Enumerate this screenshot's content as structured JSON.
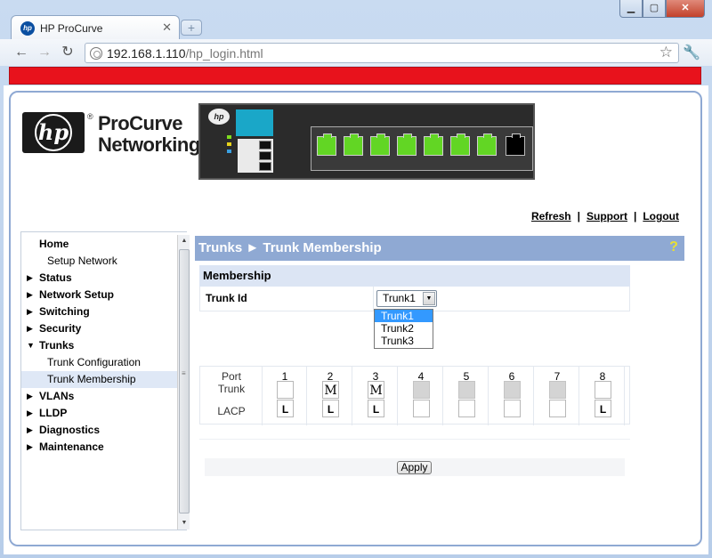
{
  "browser": {
    "tab_title": "HP ProCurve",
    "url_host": "192.168.1.110",
    "url_path": "/hp_login.html",
    "favicon_label": "hp"
  },
  "header": {
    "logo_text": "hp",
    "reg_mark": "®",
    "brand_line1": "ProCurve",
    "brand_line2": "Networking",
    "links": [
      "Refresh",
      "Support",
      "Logout"
    ]
  },
  "sidebar": {
    "items": [
      {
        "label": "Home",
        "sub": false,
        "arrow": ""
      },
      {
        "label": "Setup Network",
        "sub": true,
        "arrow": ""
      },
      {
        "label": "Status",
        "sub": false,
        "arrow": "▶"
      },
      {
        "label": "Network Setup",
        "sub": false,
        "arrow": "▶"
      },
      {
        "label": "Switching",
        "sub": false,
        "arrow": "▶"
      },
      {
        "label": "Security",
        "sub": false,
        "arrow": "▶"
      },
      {
        "label": "Trunks",
        "sub": false,
        "arrow": "▼"
      },
      {
        "label": "Trunk Configuration",
        "sub": true,
        "arrow": ""
      },
      {
        "label": "Trunk Membership",
        "sub": true,
        "arrow": "",
        "active": true
      },
      {
        "label": "VLANs",
        "sub": false,
        "arrow": "▶"
      },
      {
        "label": "LLDP",
        "sub": false,
        "arrow": "▶"
      },
      {
        "label": "Diagnostics",
        "sub": false,
        "arrow": "▶"
      },
      {
        "label": "Maintenance",
        "sub": false,
        "arrow": "▶"
      }
    ]
  },
  "main": {
    "title": "Trunks ► Trunk Membership",
    "help_label": "?",
    "membership_heading": "Membership",
    "trunk_id_label": "Trunk Id",
    "trunk_select_value": "Trunk1",
    "trunk_options": [
      "Trunk1",
      "Trunk2",
      "Trunk3"
    ],
    "port_label": "Port",
    "trunk_label": "Trunk",
    "lacp_label": "LACP",
    "ports": [
      {
        "num": "1",
        "trunk": "",
        "lacp": "L",
        "gray": false,
        "lacp_shown": true
      },
      {
        "num": "2",
        "trunk": "M",
        "lacp": "L",
        "gray": false,
        "lacp_shown": true
      },
      {
        "num": "3",
        "trunk": "M",
        "lacp": "L",
        "gray": false,
        "lacp_shown": true
      },
      {
        "num": "4",
        "trunk": "",
        "lacp": "",
        "gray": true,
        "lacp_shown": true
      },
      {
        "num": "5",
        "trunk": "",
        "lacp": "",
        "gray": true,
        "lacp_shown": true
      },
      {
        "num": "6",
        "trunk": "",
        "lacp": "",
        "gray": true,
        "lacp_shown": true
      },
      {
        "num": "7",
        "trunk": "",
        "lacp": "",
        "gray": true,
        "lacp_shown": true
      },
      {
        "num": "8",
        "trunk": "",
        "lacp": "L",
        "gray": false,
        "lacp_shown": true
      }
    ],
    "apply_label": "Apply"
  },
  "colors": {
    "header_blue": "#8fa9d3",
    "section_blue": "#dce5f4",
    "red_bar": "#e8121c",
    "port_green": "#62d624"
  }
}
